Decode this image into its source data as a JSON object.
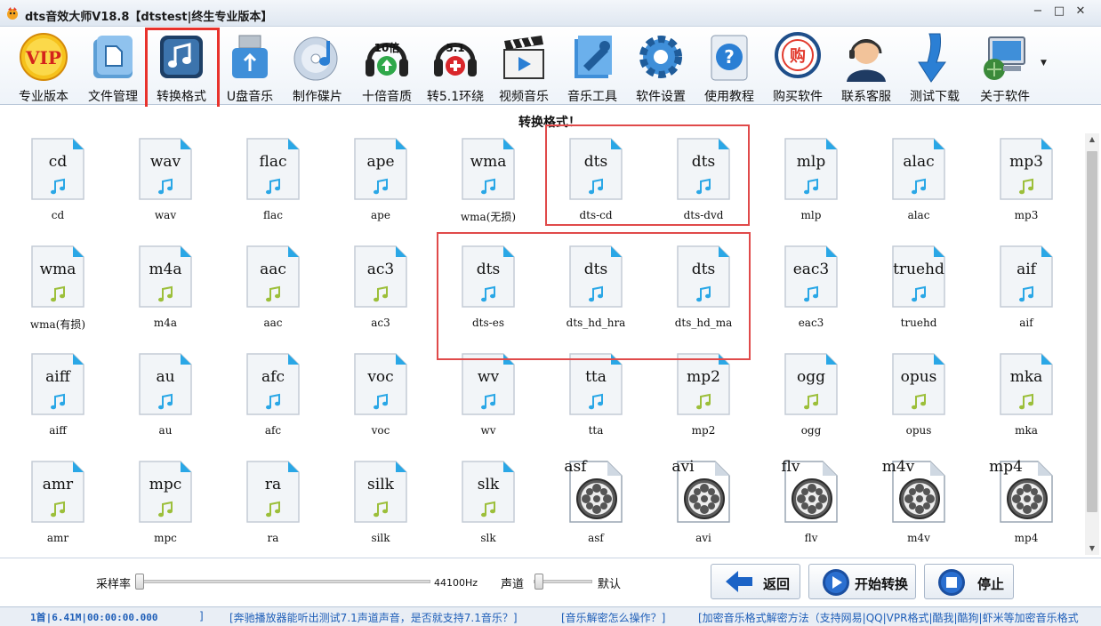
{
  "window": {
    "title": "dts音效大师V18.8【dtstest|终生专业版本】",
    "minimize": "−",
    "maximize": "□",
    "close": "✕"
  },
  "toolbar": {
    "items": [
      {
        "label": "专业版本",
        "icon": "vip-icon",
        "vip_text": "VIP"
      },
      {
        "label": "文件管理",
        "icon": "file-manager-icon"
      },
      {
        "label": "转换格式",
        "icon": "convert-format-icon",
        "selected": true
      },
      {
        "label": "U盘音乐",
        "icon": "usb-drive-icon"
      },
      {
        "label": "制作碟片",
        "icon": "cd-burn-icon"
      },
      {
        "label": "十倍音质",
        "icon": "headphones-10x-icon",
        "badge": "10倍"
      },
      {
        "label": "转5.1环绕",
        "icon": "headphones-51-icon",
        "badge": "5.1"
      },
      {
        "label": "视频音乐",
        "icon": "video-clapper-icon"
      },
      {
        "label": "音乐工具",
        "icon": "music-tools-icon"
      },
      {
        "label": "软件设置",
        "icon": "gear-icon"
      },
      {
        "label": "使用教程",
        "icon": "help-icon"
      },
      {
        "label": "购买软件",
        "icon": "buy-icon",
        "badge": "购"
      },
      {
        "label": "联系客服",
        "icon": "customer-service-icon"
      },
      {
        "label": "测试下载",
        "icon": "download-arrow-icon"
      },
      {
        "label": "关于软件",
        "icon": "about-computer-icon"
      }
    ]
  },
  "content": {
    "section_title": "转换格式！",
    "formats": [
      {
        "ext": "cd",
        "caption": "cd",
        "kind": "audio-blue"
      },
      {
        "ext": "wav",
        "caption": "wav",
        "kind": "audio-blue"
      },
      {
        "ext": "flac",
        "caption": "flac",
        "kind": "audio-blue"
      },
      {
        "ext": "ape",
        "caption": "ape",
        "kind": "audio-blue"
      },
      {
        "ext": "wma",
        "caption": "wma(无损)",
        "kind": "audio-blue"
      },
      {
        "ext": "dts",
        "caption": "dts-cd",
        "kind": "audio-blue"
      },
      {
        "ext": "dts",
        "caption": "dts-dvd",
        "kind": "audio-blue"
      },
      {
        "ext": "mlp",
        "caption": "mlp",
        "kind": "audio-blue"
      },
      {
        "ext": "alac",
        "caption": "alac",
        "kind": "audio-blue"
      },
      {
        "ext": "mp3",
        "caption": "mp3",
        "kind": "audio-green"
      },
      {
        "ext": "wma",
        "caption": "wma(有损)",
        "kind": "audio-green"
      },
      {
        "ext": "m4a",
        "caption": "m4a",
        "kind": "audio-green"
      },
      {
        "ext": "aac",
        "caption": "aac",
        "kind": "audio-green"
      },
      {
        "ext": "ac3",
        "caption": "ac3",
        "kind": "audio-green"
      },
      {
        "ext": "dts",
        "caption": "dts-es",
        "kind": "audio-blue"
      },
      {
        "ext": "dts",
        "caption": "dts_hd_hra",
        "kind": "audio-blue"
      },
      {
        "ext": "dts",
        "caption": "dts_hd_ma",
        "kind": "audio-blue"
      },
      {
        "ext": "eac3",
        "caption": "eac3",
        "kind": "audio-blue"
      },
      {
        "ext": "truehd",
        "caption": "truehd",
        "kind": "audio-blue"
      },
      {
        "ext": "aif",
        "caption": "aif",
        "kind": "audio-blue"
      },
      {
        "ext": "aiff",
        "caption": "aiff",
        "kind": "audio-blue"
      },
      {
        "ext": "au",
        "caption": "au",
        "kind": "audio-blue"
      },
      {
        "ext": "afc",
        "caption": "afc",
        "kind": "audio-blue"
      },
      {
        "ext": "voc",
        "caption": "voc",
        "kind": "audio-blue"
      },
      {
        "ext": "wv",
        "caption": "wv",
        "kind": "audio-blue"
      },
      {
        "ext": "tta",
        "caption": "tta",
        "kind": "audio-blue"
      },
      {
        "ext": "mp2",
        "caption": "mp2",
        "kind": "audio-green"
      },
      {
        "ext": "ogg",
        "caption": "ogg",
        "kind": "audio-green"
      },
      {
        "ext": "opus",
        "caption": "opus",
        "kind": "audio-green"
      },
      {
        "ext": "mka",
        "caption": "mka",
        "kind": "audio-green"
      },
      {
        "ext": "amr",
        "caption": "amr",
        "kind": "audio-green"
      },
      {
        "ext": "mpc",
        "caption": "mpc",
        "kind": "audio-green"
      },
      {
        "ext": "ra",
        "caption": "ra",
        "kind": "audio-green"
      },
      {
        "ext": "silk",
        "caption": "silk",
        "kind": "audio-green"
      },
      {
        "ext": "slk",
        "caption": "slk",
        "kind": "audio-green"
      },
      {
        "ext": "asf",
        "caption": "asf",
        "kind": "video"
      },
      {
        "ext": "avi",
        "caption": "avi",
        "kind": "video"
      },
      {
        "ext": "flv",
        "caption": "flv",
        "kind": "video"
      },
      {
        "ext": "m4v",
        "caption": "m4v",
        "kind": "video"
      },
      {
        "ext": "mp4",
        "caption": "mp4",
        "kind": "video"
      }
    ]
  },
  "controls": {
    "sample_rate_label": "采样率",
    "sample_rate_value": "44100Hz",
    "channel_label": "声道",
    "channel_value": "默认",
    "back_label": "返回",
    "start_label": "开始转换",
    "stop_label": "停止"
  },
  "status": {
    "track": "1首|6.41M|00:00:00.000",
    "close_bracket": "]",
    "tip1": "[奔驰播放器能听出测试7.1声道声音，是否就支持7.1音乐？]",
    "tip2": "[音乐解密怎么操作？]",
    "tip3": "[加密音乐格式解密方法（支持网易|QQ|VPR格式|酷我|酷狗|虾米等加密音乐格式"
  },
  "colors": {
    "highlight_red": "#e04a4a",
    "selected_tool_red": "#e8322c",
    "status_link_blue": "#1f5fb8",
    "note_blue": "#2aa7e6",
    "note_green": "#9cbf3a"
  }
}
